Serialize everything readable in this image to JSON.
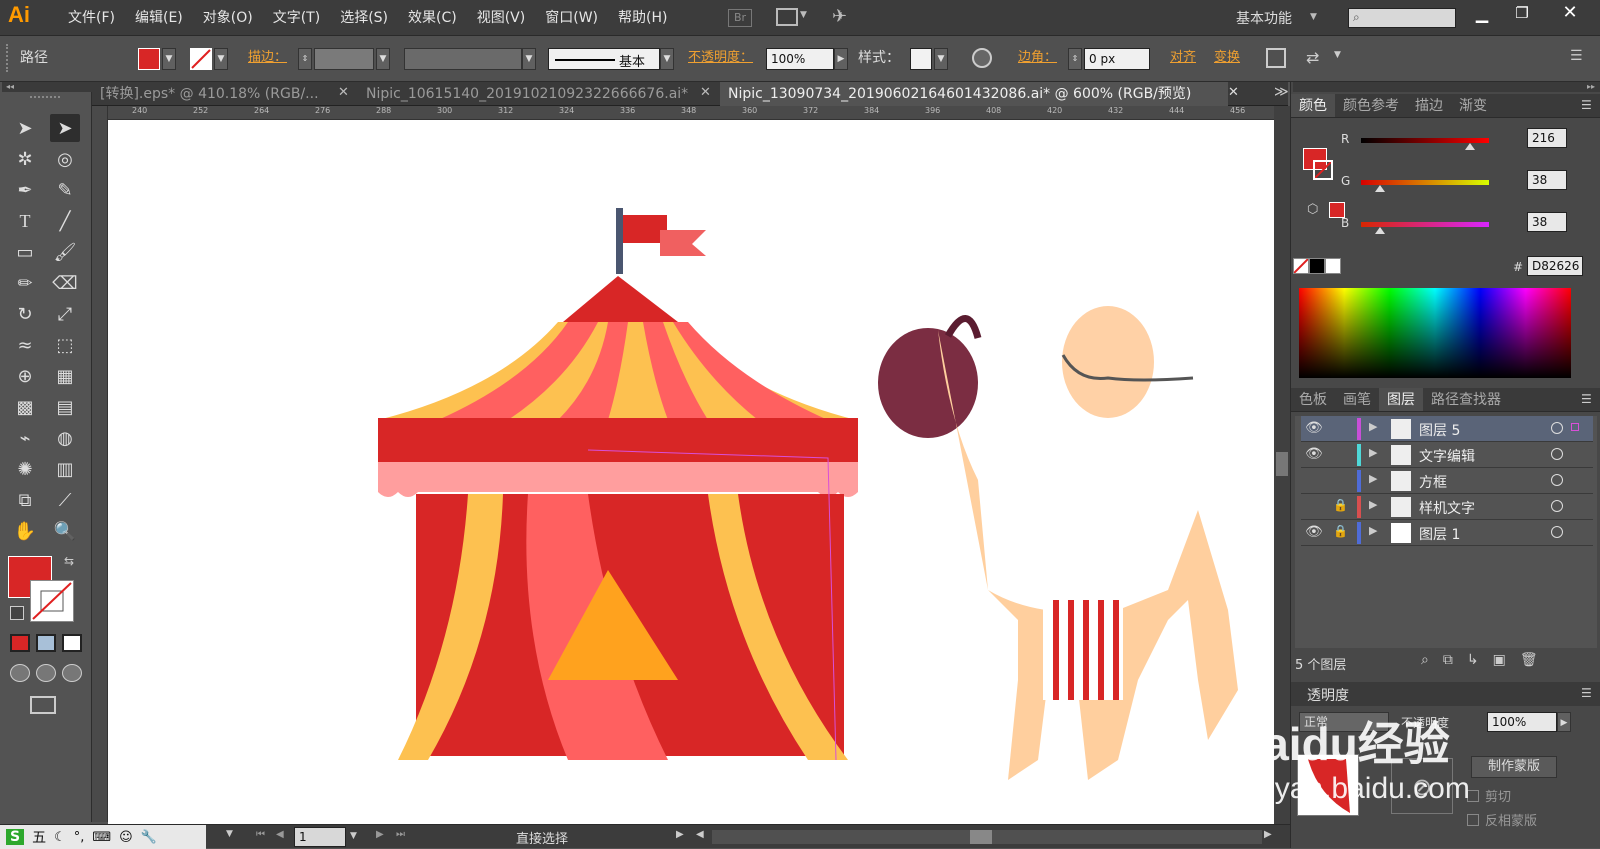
{
  "app": {
    "logo": "Ai",
    "workspace": "基本功能"
  },
  "menu": [
    "文件(F)",
    "编辑(E)",
    "对象(O)",
    "文字(T)",
    "选择(S)",
    "效果(C)",
    "视图(V)",
    "窗口(W)",
    "帮助(H)"
  ],
  "menu_extra": {
    "bridge": "Br"
  },
  "control": {
    "object_type": "路径",
    "stroke_label": "描边：",
    "stroke_style": "基本",
    "opacity_label": "不透明度：",
    "opacity_value": "100%",
    "style_label": "样式：",
    "corner_label": "边角：",
    "corner_value": "0 px",
    "align": "对齐",
    "transform": "变换"
  },
  "tabs": [
    "[转换].eps* @ 410.18% (RGB/...",
    "Nipic_10615140_20191021092322666676.ai*",
    "Nipic_13090734_20190602164601432086.ai* @ 600% (RGB/预览)"
  ],
  "ruler": [
    "240",
    "252",
    "264",
    "276",
    "288",
    "300",
    "312",
    "324",
    "336",
    "348",
    "360",
    "372",
    "384",
    "396",
    "408",
    "420",
    "432",
    "444",
    "456"
  ],
  "color_panel": {
    "tabs": [
      "颜色",
      "颜色参考",
      "描边",
      "渐变"
    ],
    "r_label": "R",
    "g_label": "G",
    "b_label": "B",
    "r": "216",
    "g": "38",
    "b": "38",
    "r_frac": 0.85,
    "g_frac": 0.15,
    "b_frac": 0.15,
    "hex_label": "#",
    "hex": "D82626",
    "fill": "#d82626"
  },
  "layers_panel": {
    "tabs": [
      "色板",
      "画笔",
      "图层",
      "路径查找器"
    ],
    "layers": [
      {
        "name": "图层 5",
        "color": "#c84fd8"
      },
      {
        "name": "文字编辑",
        "color": "#4fd8d8"
      },
      {
        "name": "方框",
        "color": "#4f6cd8"
      },
      {
        "name": "样机文字",
        "color": "#d84f4f"
      },
      {
        "name": "图层 1",
        "color": "#4f6cd8"
      }
    ],
    "count": "5 个图层"
  },
  "transparency": {
    "title": "透明度",
    "mode": "正常",
    "opacity_label": "不透明度",
    "opacity": "100%",
    "make_mask": "制作蒙版",
    "clip": "剪切",
    "invert": "反相蒙版"
  },
  "status": {
    "page": "1",
    "tool": "直接选择"
  },
  "watermark": {
    "brand": "Baidu经验",
    "url": "jingyan.baidu.com"
  },
  "ime": {
    "brand": "S",
    "mode": "五"
  }
}
